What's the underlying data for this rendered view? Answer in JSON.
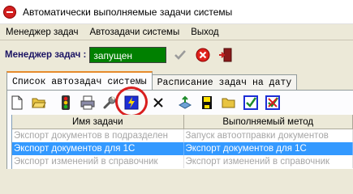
{
  "window": {
    "title": "Автоматически выполняемые задачи системы",
    "icon": "stop-icon"
  },
  "menu": {
    "items": [
      "Менеджер задач",
      "Автозадачи системы",
      "Выход"
    ]
  },
  "status": {
    "label": "Менеджер задач :",
    "value": "запущен",
    "value_color": "#008000"
  },
  "tabs": [
    {
      "label": "Список автозадач системы",
      "active": true
    },
    {
      "label": "Расписание задач на дату",
      "active": false
    }
  ],
  "toolbar": {
    "buttons": [
      "new-document-icon",
      "open-folder-icon",
      "traffic-light-icon",
      "print-icon",
      "wrench-icon",
      "lightning-icon",
      "delete-x-icon",
      "export-icon",
      "save-icon",
      "folder-icon",
      "check-icon",
      "cancel-check-icon"
    ],
    "highlight_color": "#d91e1e"
  },
  "grid": {
    "columns": [
      "Имя задачи",
      "Выполняемый метод"
    ],
    "rows": [
      [
        "Экспорт документов в подразделен",
        "Запуск автоотправки документов"
      ],
      [
        "Экспорт документов для 1С",
        "Экспорт документов для 1С"
      ],
      [
        "Экспорт изменений в справочник",
        "Экспорт изменений в справочник"
      ]
    ],
    "selected_row": 1,
    "selection_color": "#3399ff"
  }
}
